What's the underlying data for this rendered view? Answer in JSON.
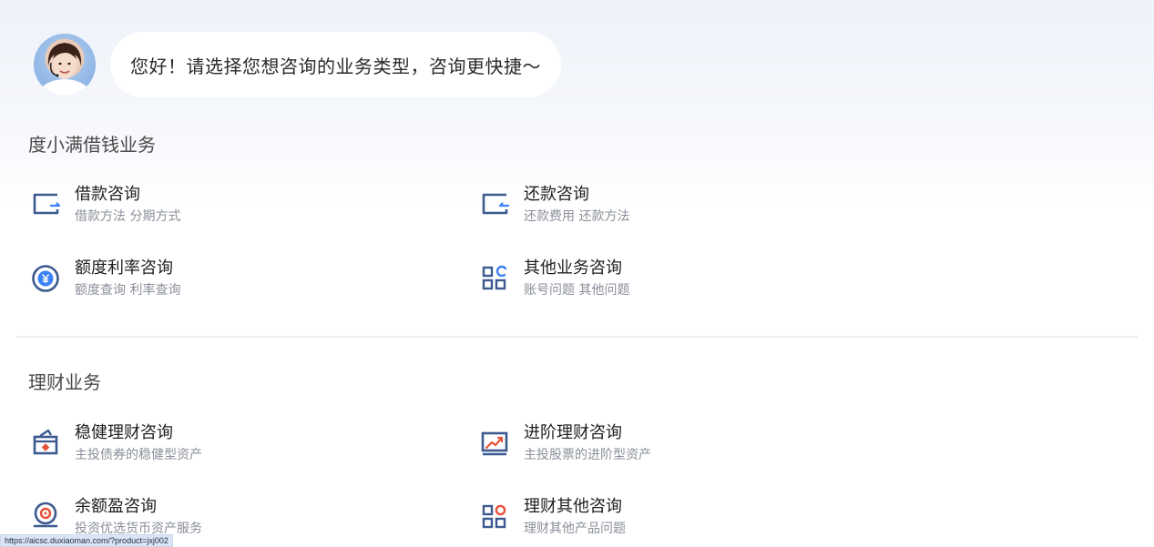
{
  "greeting": {
    "text": "您好！请选择您想咨询的业务类型，咨询更快捷～"
  },
  "sections": [
    {
      "title": "度小满借钱业务",
      "items": [
        {
          "name": "借款咨询",
          "desc": "借款方法 分期方式",
          "icon": "loan-icon"
        },
        {
          "name": "还款咨询",
          "desc": "还款费用 还款方法",
          "icon": "repay-icon"
        },
        {
          "name": "额度利率咨询",
          "desc": "额度查询 利率查询",
          "icon": "yen-coin-icon"
        },
        {
          "name": "其他业务咨询",
          "desc": "账号问题 其他问题",
          "icon": "grid-apps-icon"
        }
      ]
    },
    {
      "title": "理财业务",
      "items": [
        {
          "name": "稳健理财咨询",
          "desc": "主投债券的稳健型资产",
          "icon": "wallet-lock-icon"
        },
        {
          "name": "进阶理财咨询",
          "desc": "主投股票的进阶型资产",
          "icon": "trend-chart-icon"
        },
        {
          "name": "余额盈咨询",
          "desc": "投资优选货币资产服务",
          "icon": "coin-stack-icon"
        },
        {
          "name": "理财其他咨询",
          "desc": "理财其他产品问题",
          "icon": "grid-circle-icon"
        }
      ]
    }
  ],
  "status_bar": {
    "url": "https://aicsc.duxiaoman.com/?product=jxj002"
  },
  "colors": {
    "icon_blue": "#3d5a8f",
    "accent_red": "#e8503a",
    "accent_blue": "#3b82f6"
  }
}
